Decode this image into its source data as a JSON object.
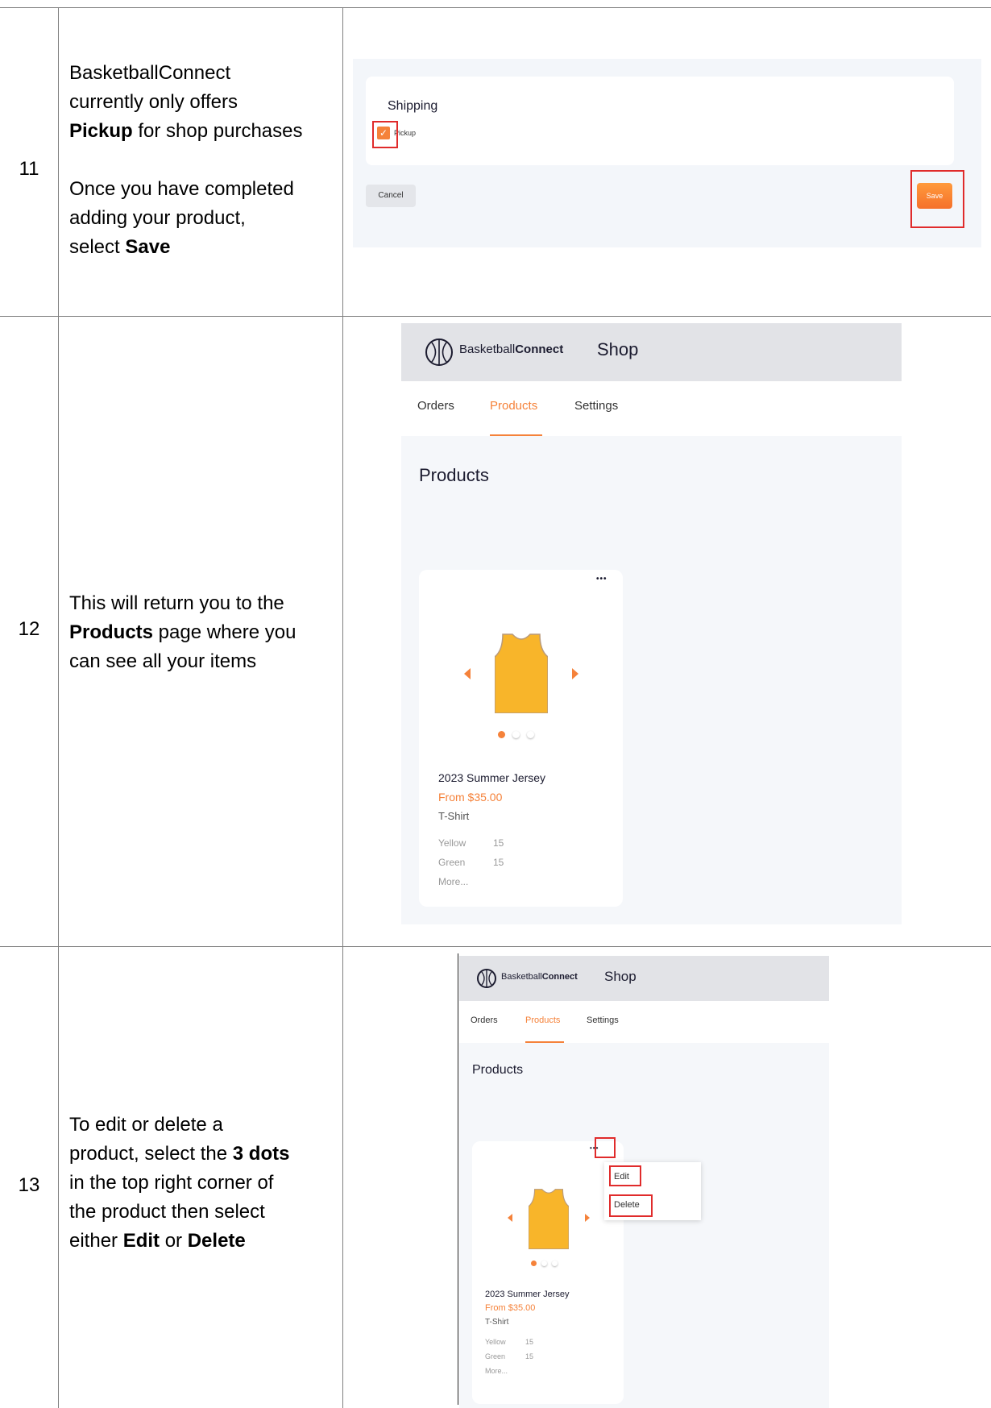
{
  "steps": [
    {
      "number": "11",
      "text_html_parts": {
        "l1": "BasketballConnect",
        "l2": "currently only offers",
        "l3_bold": "Pickup",
        "l3_rest": " for shop purchases",
        "l4": "Once you have completed",
        "l5": "adding your product,",
        "l6_pre": "select ",
        "l6_bold": "Save"
      }
    },
    {
      "number": "12",
      "text_html_parts": {
        "l1": "This will return you to the",
        "l2_bold": "Products",
        "l2_rest": " page where you",
        "l3": "can see all your items"
      }
    },
    {
      "number": "13",
      "text_html_parts": {
        "l1": "To edit or delete a",
        "l2_pre": "product, select the ",
        "l2_bold": "3 dots",
        "l3": "in the top right corner of",
        "l4": "the product then select",
        "l5_pre": "either ",
        "l5_bold1": "Edit",
        "l5_mid": " or ",
        "l5_bold2": "Delete"
      }
    }
  ],
  "shot11": {
    "shipping_title": "Shipping",
    "pickup_label": "Pickup",
    "check_glyph": "✓",
    "cancel_label": "Cancel",
    "save_label": "Save"
  },
  "app": {
    "brand_regular": "Basketball",
    "brand_bold": "Connect",
    "shop_title": "Shop",
    "tabs": [
      "Orders",
      "Products",
      "Settings"
    ],
    "active_tab": "Products",
    "page_title": "Products",
    "more_menu_glyph": "•••",
    "product": {
      "name": "2023 Summer Jersey",
      "price": "From $35.00",
      "type": "T-Shirt",
      "variants": [
        {
          "name": "Yellow",
          "qty": "15"
        },
        {
          "name": "Green",
          "qty": "15"
        }
      ],
      "more_label": "More..."
    },
    "menu_items": [
      "Edit",
      "Delete"
    ]
  },
  "colors": {
    "accent": "#f5823a",
    "header_bg": "#e2e3e7",
    "page_bg": "#f5f7fa",
    "highlight_box": "#e02b2b",
    "jersey": "#f8b52a"
  }
}
